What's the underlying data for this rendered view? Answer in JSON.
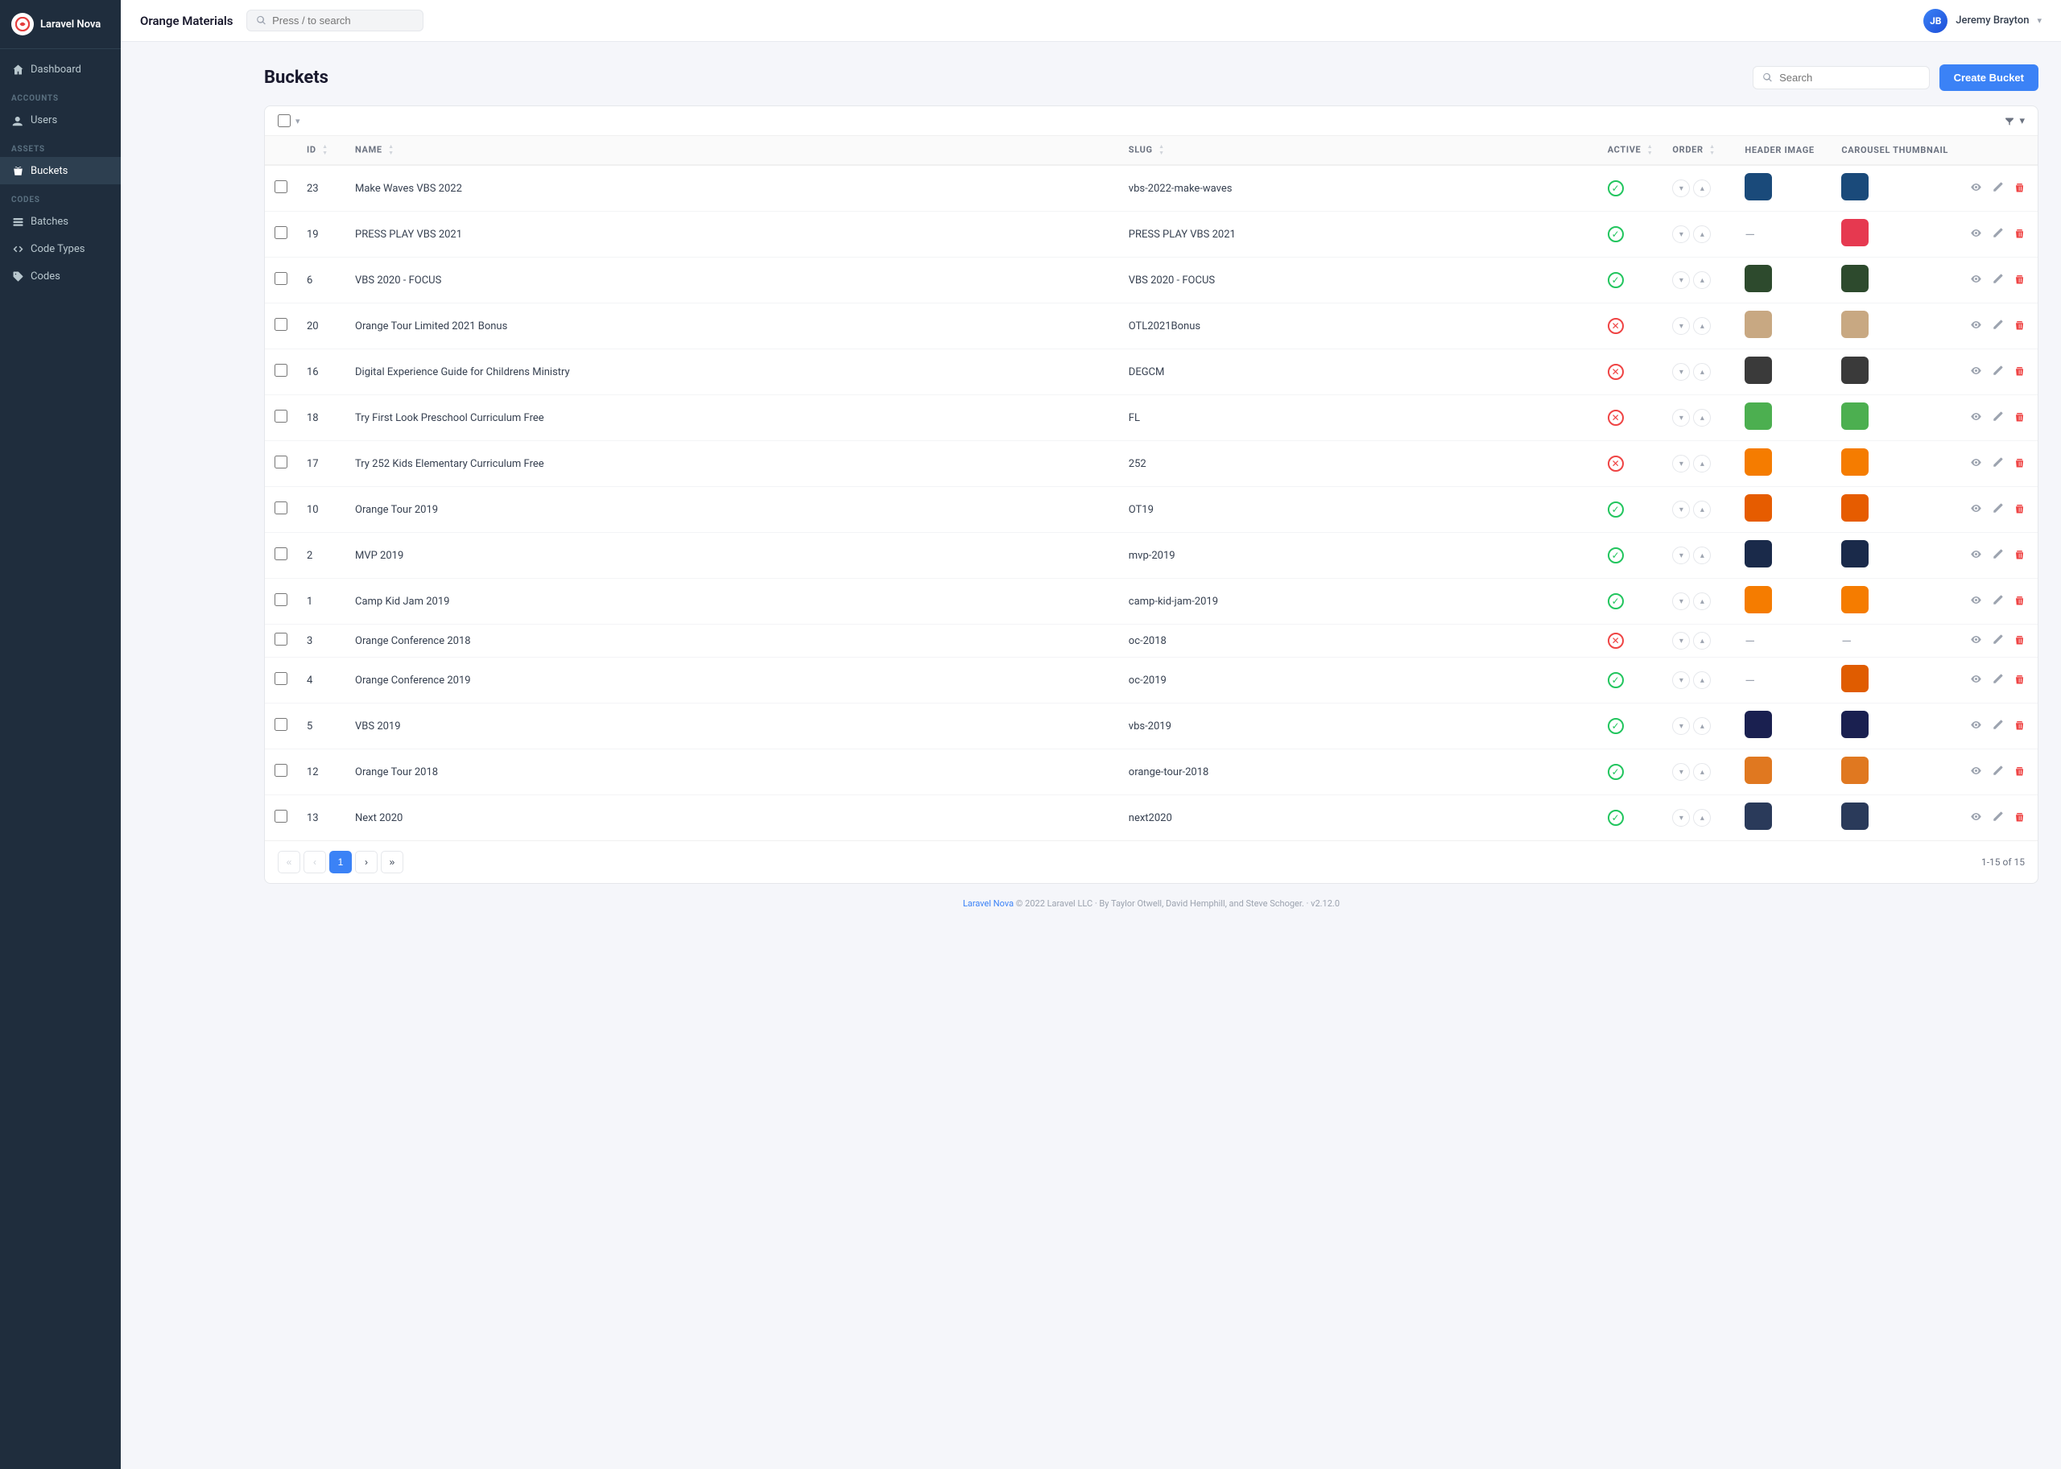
{
  "app": {
    "name": "Laravel Nova"
  },
  "topbar": {
    "title": "Orange Materials",
    "search_placeholder": "Press / to search",
    "user_name": "Jeremy Brayton",
    "user_initials": "JB"
  },
  "sidebar": {
    "logo_text": "Laravel Nova",
    "nav_items": [
      {
        "id": "dashboard",
        "label": "Dashboard",
        "icon": "home"
      }
    ],
    "sections": [
      {
        "label": "ACCOUNTS",
        "items": [
          {
            "id": "users",
            "label": "Users",
            "icon": "users"
          }
        ]
      },
      {
        "label": "ASSETS",
        "items": [
          {
            "id": "buckets",
            "label": "Buckets",
            "icon": "bucket",
            "active": true
          }
        ]
      },
      {
        "label": "CODES",
        "items": [
          {
            "id": "batches",
            "label": "Batches",
            "icon": "batches"
          },
          {
            "id": "code-types",
            "label": "Code Types",
            "icon": "code"
          },
          {
            "id": "codes",
            "label": "Codes",
            "icon": "tag"
          }
        ]
      }
    ]
  },
  "page": {
    "title": "Buckets",
    "search_placeholder": "Search",
    "create_button": "Create Bucket"
  },
  "table": {
    "columns": [
      "",
      "ID",
      "NAME",
      "SLUG",
      "ACTIVE",
      "ORDER",
      "HEADER IMAGE",
      "CAROUSEL THUMBNAIL",
      ""
    ],
    "rows": [
      {
        "id": 23,
        "name": "Make Waves VBS 2022",
        "slug": "vbs-2022-make-waves",
        "active": true,
        "thumb_class": "thumb-makewaves",
        "carousel_class": "thumb-makewaves"
      },
      {
        "id": 19,
        "name": "PRESS PLAY VBS 2021",
        "slug": "PRESS PLAY VBS 2021",
        "active": true,
        "thumb_class": "",
        "carousel_class": "thumb-pressplay",
        "no_header": true
      },
      {
        "id": 6,
        "name": "VBS 2020 - FOCUS",
        "slug": "VBS 2020 - FOCUS",
        "active": true,
        "thumb_class": "thumb-vbs2020",
        "carousel_class": "thumb-vbs2020"
      },
      {
        "id": 20,
        "name": "Orange Tour Limited 2021 Bonus",
        "slug": "OTL2021Bonus",
        "active": false,
        "thumb_class": "thumb-otl2021",
        "carousel_class": "thumb-otl2021"
      },
      {
        "id": 16,
        "name": "Digital Experience Guide for Childrens Ministry",
        "slug": "DEGCM",
        "active": false,
        "thumb_class": "thumb-degcm",
        "carousel_class": "thumb-degcm"
      },
      {
        "id": 18,
        "name": "Try First Look Preschool Curriculum Free",
        "slug": "FL",
        "active": false,
        "thumb_class": "thumb-firstlook",
        "carousel_class": "thumb-firstlook"
      },
      {
        "id": 17,
        "name": "Try 252 Kids Elementary Curriculum Free",
        "slug": "252",
        "active": false,
        "thumb_class": "thumb-252kids",
        "carousel_class": "thumb-252kids"
      },
      {
        "id": 10,
        "name": "Orange Tour 2019",
        "slug": "OT19",
        "active": true,
        "thumb_class": "thumb-ot19",
        "carousel_class": "thumb-ot19"
      },
      {
        "id": 2,
        "name": "MVP 2019",
        "slug": "mvp-2019",
        "active": true,
        "thumb_class": "thumb-mvp2019",
        "carousel_class": "thumb-mvp2019"
      },
      {
        "id": 1,
        "name": "Camp Kid Jam 2019",
        "slug": "camp-kid-jam-2019",
        "active": true,
        "thumb_class": "thumb-campkid",
        "carousel_class": "thumb-campkid"
      },
      {
        "id": 3,
        "name": "Orange Conference 2018",
        "slug": "oc-2018",
        "active": false,
        "no_header": true,
        "no_carousel": true
      },
      {
        "id": 4,
        "name": "Orange Conference 2019",
        "slug": "oc-2019",
        "active": true,
        "no_header": true,
        "carousel_class": "thumb-oc2019"
      },
      {
        "id": 5,
        "name": "VBS 2019",
        "slug": "vbs-2019",
        "active": true,
        "thumb_class": "thumb-vbs2019",
        "carousel_class": "thumb-vbs2019"
      },
      {
        "id": 12,
        "name": "Orange Tour 2018",
        "slug": "orange-tour-2018",
        "active": true,
        "thumb_class": "thumb-ot2018",
        "carousel_class": "thumb-ot2018"
      },
      {
        "id": 13,
        "name": "Next 2020",
        "slug": "next2020",
        "active": true,
        "no_order_up": true,
        "thumb_class": "thumb-next2020",
        "carousel_class": "thumb-next2020"
      }
    ]
  },
  "pagination": {
    "first_label": "«",
    "prev_label": "‹",
    "current_page": 1,
    "next_label": "›",
    "last_label": "»",
    "range_text": "1-15 of 15"
  },
  "footer": {
    "link_text": "Laravel Nova",
    "copyright": "© 2022 Laravel LLC · By Taylor Otwell, David Hemphill, and Steve Schoger. · v2.12.0"
  }
}
